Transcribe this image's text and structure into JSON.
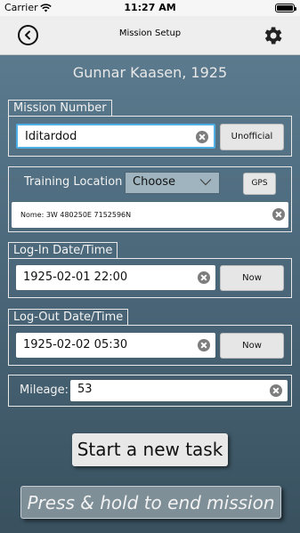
{
  "status": {
    "carrier": "Carrier",
    "time": "11:27 AM"
  },
  "nav": {
    "title": "Mission Setup",
    "back_icon": "back-circle-icon",
    "settings_icon": "gear-icon"
  },
  "pilot_name": "Gunnar Kaasen, 1925",
  "mission": {
    "label": "Mission Number",
    "value": "Iditardod",
    "button": "Unofficial"
  },
  "training": {
    "label": "Training Location",
    "select_value": "Choose",
    "gps_button": "GPS",
    "location_text": "Nome: 3W 480250E  7152596N"
  },
  "login": {
    "label": "Log-In Date/Time",
    "value": "1925-02-01 22:00",
    "button": "Now"
  },
  "logout": {
    "label": "Log-Out Date/Time",
    "value": "1925-02-02 05:30",
    "button": "Now"
  },
  "mileage": {
    "label": "Mileage:",
    "value": "53"
  },
  "start_button": "Start a new task",
  "end_button": "Press & hold to end mission",
  "colors": {
    "background": "#4d6a7d",
    "focus": "#4fb0e8",
    "nav": "#eeeeee"
  }
}
